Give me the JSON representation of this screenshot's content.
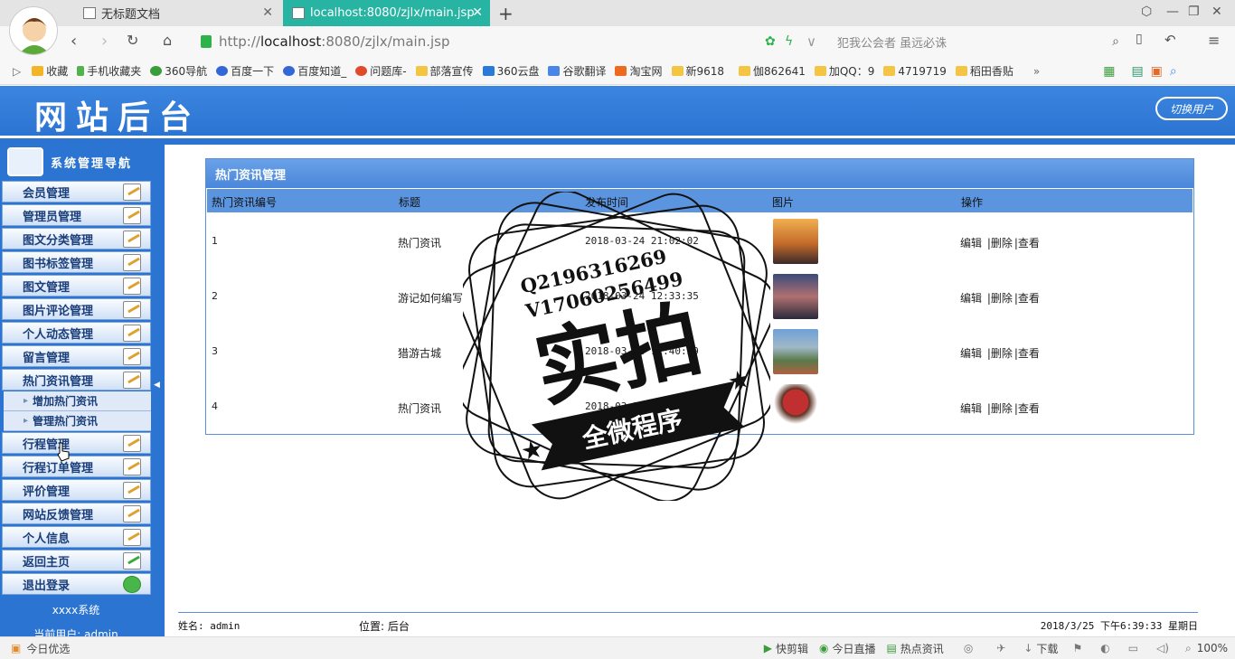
{
  "browser": {
    "tabs": [
      {
        "label": "无标题文档",
        "active": false
      },
      {
        "label": "localhost:8080/zjlx/main.jsp",
        "active": true
      }
    ],
    "url_prefix": "http://",
    "url_host": "localhost",
    "url_rest": ":8080/zjlx/main.jsp",
    "search_placeholder": "犯我公会者 虽远必诛",
    "bookmarks": [
      "收藏",
      "手机收藏夹",
      "360导航",
      "百度一下",
      "百度知道_",
      "问题库-",
      "部落宣传",
      "360云盘",
      "谷歌翻译",
      "淘宝网",
      "新9618",
      "伽862641",
      "加QQ：9",
      "4719719",
      "稻田香贴"
    ],
    "more": "»",
    "status_left": "今日优选",
    "status_items": [
      "快剪辑",
      "今日直播",
      "热点资讯",
      "下载"
    ],
    "zoom": "100%"
  },
  "app": {
    "title": "网站后台",
    "switch_user": "切换用户",
    "nav_title": "系统管理导航",
    "menu": [
      "会员管理",
      "管理员管理",
      "图文分类管理",
      "图书标签管理",
      "图文管理",
      "图片评论管理",
      "个人动态管理",
      "留言管理",
      "热门资讯管理"
    ],
    "submenu": [
      "增加热门资讯",
      "管理热门资讯"
    ],
    "menu2": [
      "行程管理",
      "行程订单管理",
      "评价管理",
      "网站反馈管理",
      "个人信息",
      "返回主页",
      "退出登录"
    ],
    "system_name": "xxxx系统",
    "current_user": "当前用户: admin"
  },
  "panel": {
    "title": "热门资讯管理",
    "columns": [
      "热门资讯编号",
      "标题",
      "发布时间",
      "图片",
      "操作"
    ],
    "rows": [
      {
        "id": "1",
        "title": "热门资讯",
        "time": "2018-03-24 21:02:02",
        "img_color": "#d9833a"
      },
      {
        "id": "2",
        "title": "游记如何编写",
        "time": "2018-03-24 12:33:35",
        "img_color": "#6a5a8a"
      },
      {
        "id": "3",
        "title": "猎游古城",
        "time": "2018-03-24 12:40:29",
        "img_color": "#7aa4c8"
      },
      {
        "id": "4",
        "title": "热门资讯",
        "time": "2018-03-24 11:56:12",
        "img_color": "#b04030"
      }
    ],
    "actions": [
      "编辑",
      "|删除",
      "|查看"
    ]
  },
  "watermark": {
    "line1": "Q2196316269",
    "line2": "V17060256499",
    "big": "实拍",
    "ribbon": "全微程序"
  },
  "footer": {
    "name": "姓名: admin",
    "location": "位置: 后台",
    "datetime": "2018/3/25 下午6:39:33 星期日"
  }
}
